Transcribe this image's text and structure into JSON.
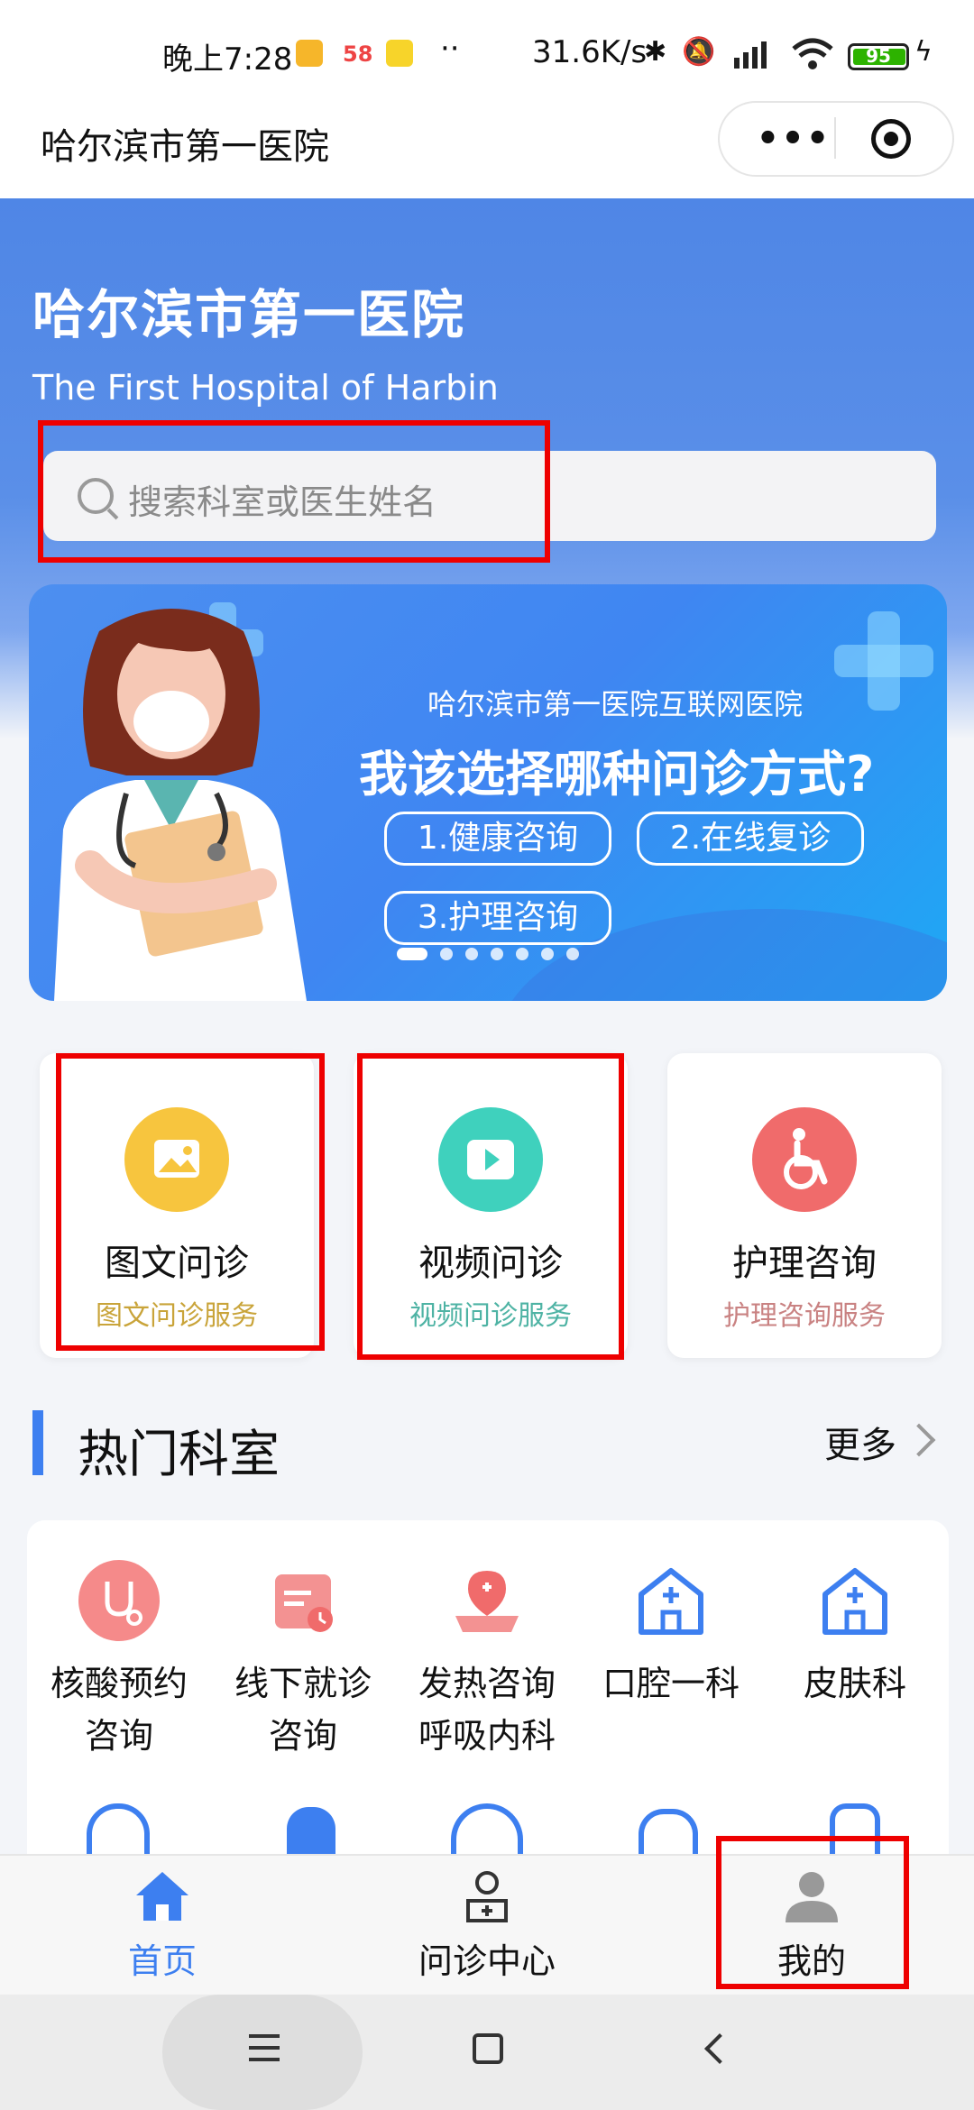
{
  "status_bar": {
    "time": "晚上7:28",
    "app_badge_58": "58",
    "dots": "··",
    "network_speed": "31.6K/s",
    "battery": "95"
  },
  "mini_program": {
    "title": "哈尔滨市第一医院",
    "menu_dots": "•••"
  },
  "hero": {
    "title": "哈尔滨市第一医院",
    "subtitle": "The First Hospital of Harbin"
  },
  "search": {
    "placeholder": "搜索科室或医生姓名"
  },
  "banner": {
    "line1": "哈尔滨市第一医院互联网医院",
    "line2": "我该选择哪种问诊方式?",
    "options": [
      "1.健康咨询",
      "2.在线复诊",
      "3.护理咨询"
    ],
    "slide_count": 7,
    "active_slide": 1
  },
  "services": [
    {
      "title": "图文问诊",
      "desc": "图文问诊服务",
      "icon": "image-icon",
      "color": "#f7c53e",
      "desc_color": "#c9a43a"
    },
    {
      "title": "视频问诊",
      "desc": "视频问诊服务",
      "icon": "video-play-icon",
      "color": "#3fd1bd",
      "desc_color": "#4eb3a4"
    },
    {
      "title": "护理咨询",
      "desc": "护理咨询服务",
      "icon": "wheelchair-icon",
      "color": "#f06b6b",
      "desc_color": "#c98282"
    }
  ],
  "hot_departments": {
    "title": "热门科室",
    "more": "更多",
    "items": [
      {
        "line1": "核酸预约",
        "line2": "咨询",
        "icon": "stethoscope-icon"
      },
      {
        "line1": "线下就诊",
        "line2": "咨询",
        "icon": "calendar-icon"
      },
      {
        "line1": "发热咨询",
        "line2": "呼吸内科",
        "icon": "medical-kit-icon"
      },
      {
        "line1": "口腔一科",
        "line2": "",
        "icon": "hospital-icon"
      },
      {
        "line1": "皮肤科",
        "line2": "",
        "icon": "hospital-icon"
      }
    ]
  },
  "tab_bar": {
    "items": [
      {
        "label": "首页",
        "icon": "home-icon",
        "active": true
      },
      {
        "label": "问诊中心",
        "icon": "doctor-icon",
        "active": false
      },
      {
        "label": "我的",
        "icon": "user-icon",
        "active": false
      }
    ]
  },
  "colors": {
    "accent": "#3d7ff0",
    "highlight_box": "#e00000"
  }
}
